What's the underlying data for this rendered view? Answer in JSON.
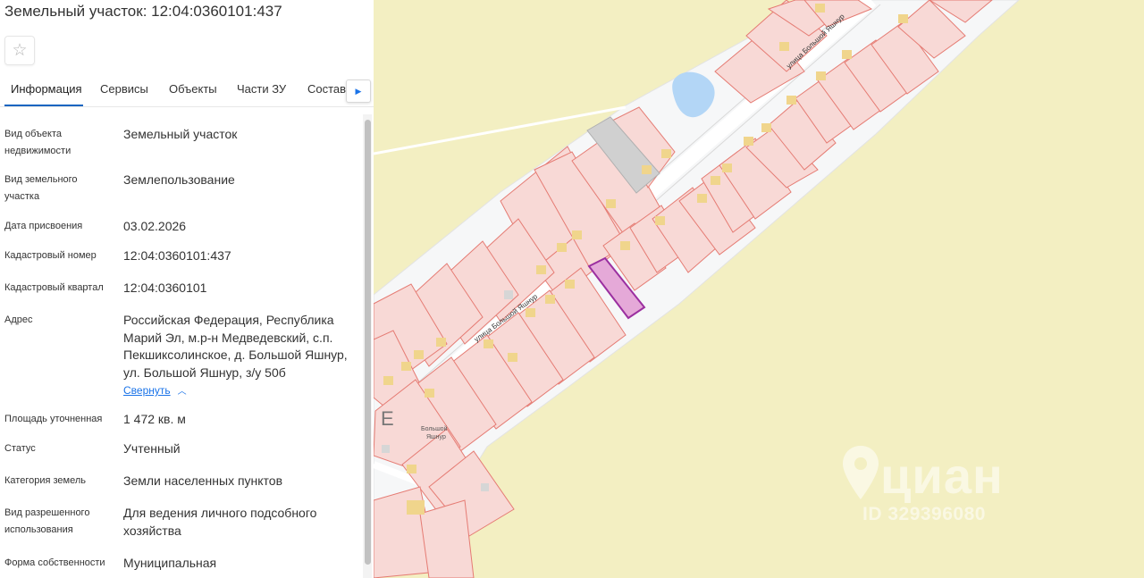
{
  "panel": {
    "title": "Земельный участок: 12:04:0360101:437",
    "favorite_icon": "star-outline-icon",
    "tabs": [
      "Информация",
      "Сервисы",
      "Объекты",
      "Части ЗУ",
      "Состав"
    ],
    "active_tab": "Информация",
    "tabs_next_icon": "caret-right-icon",
    "fields": [
      {
        "label": "Вид объекта недвижимости",
        "value": "Земельный участок"
      },
      {
        "label": "Вид земельного участка",
        "value": "Землепользование"
      },
      {
        "label": "Дата присвоения",
        "value": "03.02.2026"
      },
      {
        "label": "Кадастровый номер",
        "value": "12:04:0360101:437"
      },
      {
        "label": "Кадастровый квартал",
        "value": "12:04:0360101"
      },
      {
        "label": "Адрес",
        "value": "Российская Федерация, Республика Марий Эл, м.р-н Медведевский, с.п. Пекшиксолинское, д. Большой Яшнур, ул. Большой Яшнур, з/у 50б"
      },
      {
        "label": "Площадь уточненная",
        "value": "1 472 кв. м"
      },
      {
        "label": "Статус",
        "value": "Учтенный"
      },
      {
        "label": "Категория земель",
        "value": "Земли населенных пунктов"
      },
      {
        "label": "Вид разрешенного использования",
        "value": "Для ведения личного подсобного хозяйства"
      },
      {
        "label": "Форма собственности",
        "value": "Муниципальная"
      }
    ],
    "collapse_link": "Свернуть",
    "collapse_icon": "chevron-up-icon"
  },
  "map": {
    "street_label_upper": "улица Большой Яшнур",
    "street_label_lower": "улица Большой Яшнур",
    "village_label_line1": "Большой",
    "village_label_line2": "Яшнур",
    "watermark_brand": "циан",
    "watermark_id": "ID 329396080",
    "colors": {
      "field": "#f3efc2",
      "street_area": "#f6f7f8",
      "parcel_fill": "#f8d9d6",
      "parcel_stroke": "#e57b73",
      "building": "#f0d58c",
      "selected_fill": "#e5a9d8",
      "selected_stroke": "#9b2fa0",
      "pond": "#b3d6f6"
    }
  }
}
